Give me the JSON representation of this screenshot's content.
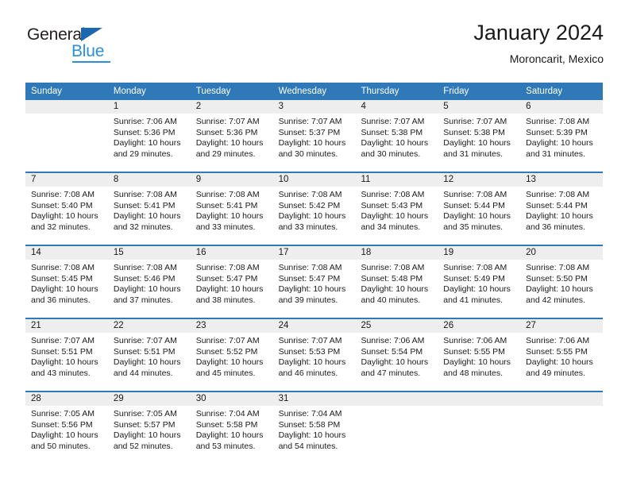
{
  "brand": {
    "name_primary": "General",
    "name_secondary": "Blue",
    "triangle_icon": "triangle-icon",
    "primary_color": "#231f20",
    "secondary_color": "#2a8fd4"
  },
  "header": {
    "title": "January 2024",
    "subtitle": "Moroncarit, Mexico"
  },
  "calendar": {
    "header_color": "#3079b8",
    "day_band_color": "#eeeeee",
    "weekdays": [
      "Sunday",
      "Monday",
      "Tuesday",
      "Wednesday",
      "Thursday",
      "Friday",
      "Saturday"
    ],
    "weeks": [
      [
        {
          "day": "",
          "lines": []
        },
        {
          "day": "1",
          "lines": [
            "Sunrise: 7:06 AM",
            "Sunset: 5:36 PM",
            "Daylight: 10 hours",
            "and 29 minutes."
          ]
        },
        {
          "day": "2",
          "lines": [
            "Sunrise: 7:07 AM",
            "Sunset: 5:36 PM",
            "Daylight: 10 hours",
            "and 29 minutes."
          ]
        },
        {
          "day": "3",
          "lines": [
            "Sunrise: 7:07 AM",
            "Sunset: 5:37 PM",
            "Daylight: 10 hours",
            "and 30 minutes."
          ]
        },
        {
          "day": "4",
          "lines": [
            "Sunrise: 7:07 AM",
            "Sunset: 5:38 PM",
            "Daylight: 10 hours",
            "and 30 minutes."
          ]
        },
        {
          "day": "5",
          "lines": [
            "Sunrise: 7:07 AM",
            "Sunset: 5:38 PM",
            "Daylight: 10 hours",
            "and 31 minutes."
          ]
        },
        {
          "day": "6",
          "lines": [
            "Sunrise: 7:08 AM",
            "Sunset: 5:39 PM",
            "Daylight: 10 hours",
            "and 31 minutes."
          ]
        }
      ],
      [
        {
          "day": "7",
          "lines": [
            "Sunrise: 7:08 AM",
            "Sunset: 5:40 PM",
            "Daylight: 10 hours",
            "and 32 minutes."
          ]
        },
        {
          "day": "8",
          "lines": [
            "Sunrise: 7:08 AM",
            "Sunset: 5:41 PM",
            "Daylight: 10 hours",
            "and 32 minutes."
          ]
        },
        {
          "day": "9",
          "lines": [
            "Sunrise: 7:08 AM",
            "Sunset: 5:41 PM",
            "Daylight: 10 hours",
            "and 33 minutes."
          ]
        },
        {
          "day": "10",
          "lines": [
            "Sunrise: 7:08 AM",
            "Sunset: 5:42 PM",
            "Daylight: 10 hours",
            "and 33 minutes."
          ]
        },
        {
          "day": "11",
          "lines": [
            "Sunrise: 7:08 AM",
            "Sunset: 5:43 PM",
            "Daylight: 10 hours",
            "and 34 minutes."
          ]
        },
        {
          "day": "12",
          "lines": [
            "Sunrise: 7:08 AM",
            "Sunset: 5:44 PM",
            "Daylight: 10 hours",
            "and 35 minutes."
          ]
        },
        {
          "day": "13",
          "lines": [
            "Sunrise: 7:08 AM",
            "Sunset: 5:44 PM",
            "Daylight: 10 hours",
            "and 36 minutes."
          ]
        }
      ],
      [
        {
          "day": "14",
          "lines": [
            "Sunrise: 7:08 AM",
            "Sunset: 5:45 PM",
            "Daylight: 10 hours",
            "and 36 minutes."
          ]
        },
        {
          "day": "15",
          "lines": [
            "Sunrise: 7:08 AM",
            "Sunset: 5:46 PM",
            "Daylight: 10 hours",
            "and 37 minutes."
          ]
        },
        {
          "day": "16",
          "lines": [
            "Sunrise: 7:08 AM",
            "Sunset: 5:47 PM",
            "Daylight: 10 hours",
            "and 38 minutes."
          ]
        },
        {
          "day": "17",
          "lines": [
            "Sunrise: 7:08 AM",
            "Sunset: 5:47 PM",
            "Daylight: 10 hours",
            "and 39 minutes."
          ]
        },
        {
          "day": "18",
          "lines": [
            "Sunrise: 7:08 AM",
            "Sunset: 5:48 PM",
            "Daylight: 10 hours",
            "and 40 minutes."
          ]
        },
        {
          "day": "19",
          "lines": [
            "Sunrise: 7:08 AM",
            "Sunset: 5:49 PM",
            "Daylight: 10 hours",
            "and 41 minutes."
          ]
        },
        {
          "day": "20",
          "lines": [
            "Sunrise: 7:08 AM",
            "Sunset: 5:50 PM",
            "Daylight: 10 hours",
            "and 42 minutes."
          ]
        }
      ],
      [
        {
          "day": "21",
          "lines": [
            "Sunrise: 7:07 AM",
            "Sunset: 5:51 PM",
            "Daylight: 10 hours",
            "and 43 minutes."
          ]
        },
        {
          "day": "22",
          "lines": [
            "Sunrise: 7:07 AM",
            "Sunset: 5:51 PM",
            "Daylight: 10 hours",
            "and 44 minutes."
          ]
        },
        {
          "day": "23",
          "lines": [
            "Sunrise: 7:07 AM",
            "Sunset: 5:52 PM",
            "Daylight: 10 hours",
            "and 45 minutes."
          ]
        },
        {
          "day": "24",
          "lines": [
            "Sunrise: 7:07 AM",
            "Sunset: 5:53 PM",
            "Daylight: 10 hours",
            "and 46 minutes."
          ]
        },
        {
          "day": "25",
          "lines": [
            "Sunrise: 7:06 AM",
            "Sunset: 5:54 PM",
            "Daylight: 10 hours",
            "and 47 minutes."
          ]
        },
        {
          "day": "26",
          "lines": [
            "Sunrise: 7:06 AM",
            "Sunset: 5:55 PM",
            "Daylight: 10 hours",
            "and 48 minutes."
          ]
        },
        {
          "day": "27",
          "lines": [
            "Sunrise: 7:06 AM",
            "Sunset: 5:55 PM",
            "Daylight: 10 hours",
            "and 49 minutes."
          ]
        }
      ],
      [
        {
          "day": "28",
          "lines": [
            "Sunrise: 7:05 AM",
            "Sunset: 5:56 PM",
            "Daylight: 10 hours",
            "and 50 minutes."
          ]
        },
        {
          "day": "29",
          "lines": [
            "Sunrise: 7:05 AM",
            "Sunset: 5:57 PM",
            "Daylight: 10 hours",
            "and 52 minutes."
          ]
        },
        {
          "day": "30",
          "lines": [
            "Sunrise: 7:04 AM",
            "Sunset: 5:58 PM",
            "Daylight: 10 hours",
            "and 53 minutes."
          ]
        },
        {
          "day": "31",
          "lines": [
            "Sunrise: 7:04 AM",
            "Sunset: 5:58 PM",
            "Daylight: 10 hours",
            "and 54 minutes."
          ]
        },
        {
          "day": "",
          "lines": []
        },
        {
          "day": "",
          "lines": []
        },
        {
          "day": "",
          "lines": []
        }
      ]
    ]
  }
}
